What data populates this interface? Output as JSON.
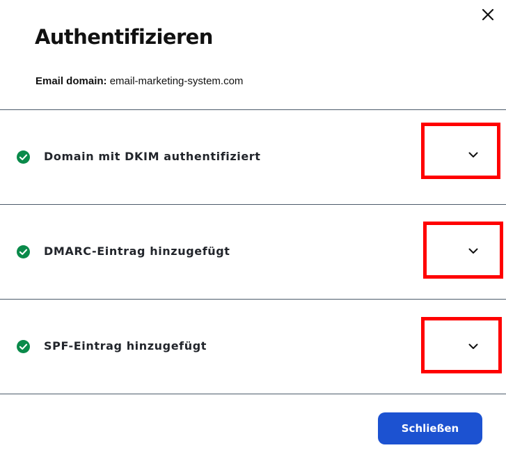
{
  "dialog": {
    "title": "Authentifizieren",
    "domain_label": "Email domain:",
    "domain_value": "email-marketing-system.com",
    "close_icon": "close-icon"
  },
  "items": [
    {
      "label": "Domain mit DKIM authentifiziert",
      "status": "verified",
      "icon": "check-circle-icon"
    },
    {
      "label": "DMARC-Eintrag hinzugefügt",
      "status": "verified",
      "icon": "check-circle-icon"
    },
    {
      "label": "SPF-Eintrag hinzugefügt",
      "status": "verified",
      "icon": "check-circle-icon"
    }
  ],
  "footer": {
    "close_button_label": "Schließen"
  },
  "colors": {
    "check_green": "#0a8a4a",
    "primary_button": "#1c52d1",
    "highlight_box": "#ff0000",
    "divider": "#4b5a6a"
  }
}
